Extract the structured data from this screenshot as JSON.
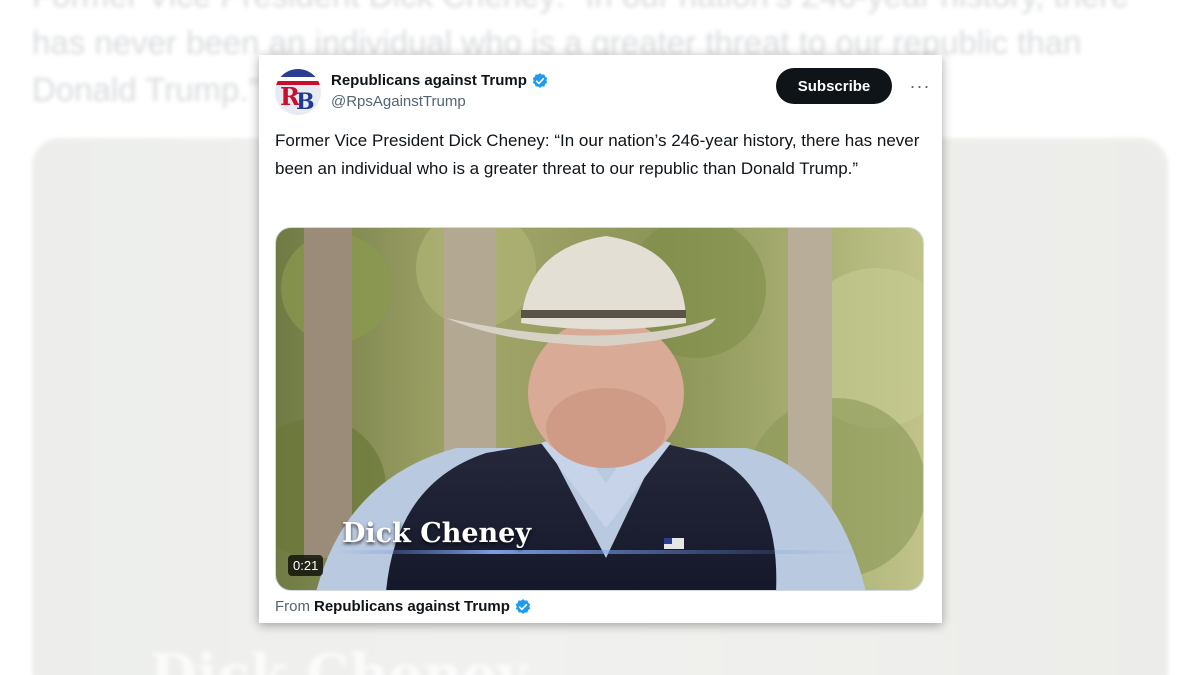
{
  "background": {
    "tweet_text": "Former Vice President Dick Cheney: “In our nation’s 246-year history, there has never been an individual who is a greater threat to our republic than Donald Trump.”",
    "video_caption": "Dick Cheney"
  },
  "tweet": {
    "display_name": "Republicans against Trump",
    "handle": "@RpsAgainstTrump",
    "verified_icon": "verified-badge-icon",
    "subscribe_label": "Subscribe",
    "more_label": "···",
    "text": "Former Vice President Dick Cheney: “In our nation’s 246-year history, there has never been an individual who is a greater threat to our republic than Donald Trump.”",
    "media": {
      "duration": "0:21",
      "caption": "Dick Cheney"
    },
    "from_prefix": "From",
    "from_name": "Republicans against Trump"
  },
  "colors": {
    "verified": "#1d9bf0",
    "subscribe_bg": "#0f1419",
    "secondary_text": "#536471"
  }
}
